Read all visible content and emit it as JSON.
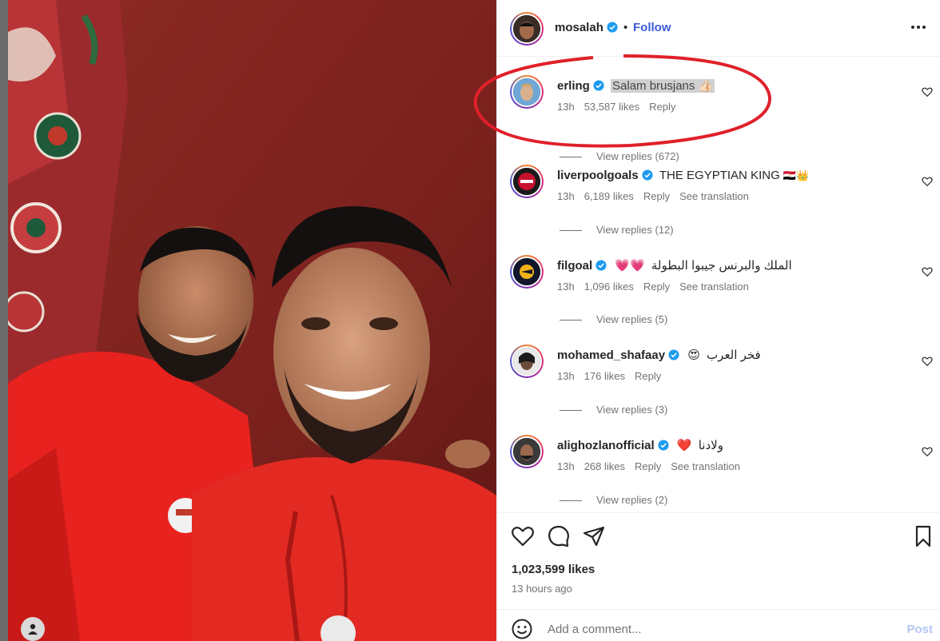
{
  "post": {
    "username": "mosalah",
    "follow_label": "Follow",
    "dot": "•",
    "likes": "1,023,599 likes",
    "time_ago": "13 hours ago"
  },
  "comments": [
    {
      "user": "erling",
      "verified": true,
      "text": "Salam brusjans",
      "emoji": "👍🏻",
      "time": "13h",
      "likes": "53,587 likes",
      "reply": "Reply",
      "translation": "",
      "view_replies": "View replies (672)",
      "highlighted": true
    },
    {
      "user": "liverpoolgoals",
      "verified": true,
      "text": "THE EGYPTIAN KING",
      "emoji": "🇪🇬👑",
      "time": "13h",
      "likes": "6,189 likes",
      "reply": "Reply",
      "translation": "See translation",
      "view_replies": "View replies (12)"
    },
    {
      "user": "filgoal",
      "verified": true,
      "text": "الملك والبرنس جيبوا البطولة",
      "emoji": "💗💗",
      "time": "13h",
      "likes": "1,096 likes",
      "reply": "Reply",
      "translation": "See translation",
      "view_replies": "View replies (5)"
    },
    {
      "user": "mohamed_shafaay",
      "verified": true,
      "text": "فخر العرب",
      "emoji": "😍",
      "time": "13h",
      "likes": "176 likes",
      "reply": "Reply",
      "translation": "",
      "view_replies": "View replies (3)"
    },
    {
      "user": "alighozlanofficial",
      "verified": true,
      "text": "ولادنا",
      "emoji": "❤️",
      "time": "13h",
      "likes": "268 likes",
      "reply": "Reply",
      "translation": "See translation",
      "view_replies": "View replies (2)"
    }
  ],
  "compose": {
    "placeholder": "Add a comment...",
    "post_label": "Post"
  },
  "icons": {
    "like": "heart-icon",
    "comment": "comment-icon",
    "share": "send-icon",
    "save": "bookmark-icon",
    "more": "more-options-icon",
    "emoji": "emoji-icon",
    "verified": "verified-badge-icon"
  },
  "colors": {
    "follow": "#3b5bd6",
    "verified": "#1d9bf0",
    "annotation": "#e0202a",
    "shirt": "#e8221f",
    "wall": "#7d2420"
  }
}
